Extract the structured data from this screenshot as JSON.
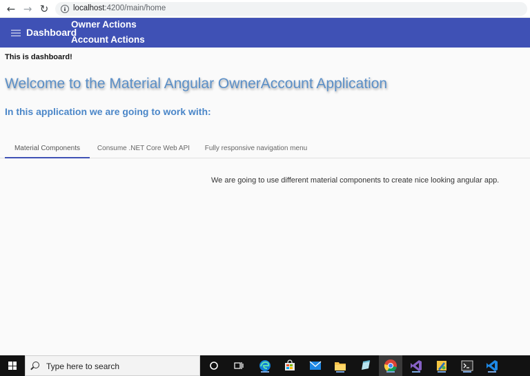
{
  "browser": {
    "url_host": "localhost",
    "url_path": ":4200/main/home"
  },
  "toolbar": {
    "brand": "Dashboard",
    "links": [
      "Owner Actions",
      "Account Actions"
    ],
    "color": "#3f51b5"
  },
  "content": {
    "dashboard_text": "This is dashboard!",
    "welcome": "Welcome to the Material Angular OwnerAccount Application",
    "subtitle": "In this application we are going to work with:",
    "tabs": [
      {
        "label": "Material Components",
        "active": true
      },
      {
        "label": "Consume .NET Core Web API",
        "active": false
      },
      {
        "label": "Fully responsive navigation menu",
        "active": false
      }
    ],
    "tab_body": "We are going to use different material components to create nice looking angular app."
  },
  "taskbar": {
    "search_placeholder": "Type here to search",
    "icons": [
      "cortana-icon",
      "task-view-icon",
      "edge-icon",
      "store-icon",
      "mail-icon",
      "file-explorer-icon",
      "notes-icon",
      "chrome-icon",
      "visual-studio-icon",
      "paint-icon",
      "terminal-icon",
      "vscode-icon"
    ]
  }
}
